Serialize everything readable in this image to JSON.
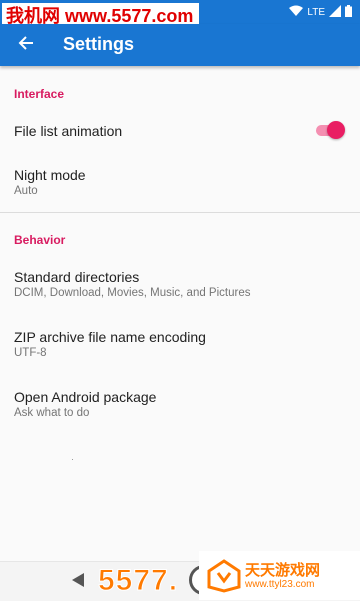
{
  "status_bar": {
    "watermark": "我机网 www.5577.com",
    "network": "LTE",
    "icons": [
      "wifi-icon",
      "lte-icon",
      "signal-icon",
      "battery-icon"
    ]
  },
  "app_bar": {
    "title": "Settings",
    "back_icon": "arrow-back-icon"
  },
  "sections": {
    "interface": {
      "header": "Interface",
      "file_list_animation": {
        "title": "File list animation",
        "enabled": true
      },
      "night_mode": {
        "title": "Night mode",
        "summary": "Auto"
      }
    },
    "behavior": {
      "header": "Behavior",
      "standard_directories": {
        "title": "Standard directories",
        "summary": "DCIM, Download, Movies, Music, and Pictures"
      },
      "zip_encoding": {
        "title": "ZIP archive file name encoding",
        "summary": "UTF-8"
      },
      "open_android_package": {
        "title": "Open Android package",
        "summary": "Ask what to do"
      }
    }
  },
  "bottom_watermark": {
    "number": "5577.",
    "site_name": "天天游戏网",
    "url": "www.ttyl23.com"
  },
  "colors": {
    "primary": "#1976d2",
    "accent": "#e91e63",
    "section_header": "#d81b60"
  }
}
